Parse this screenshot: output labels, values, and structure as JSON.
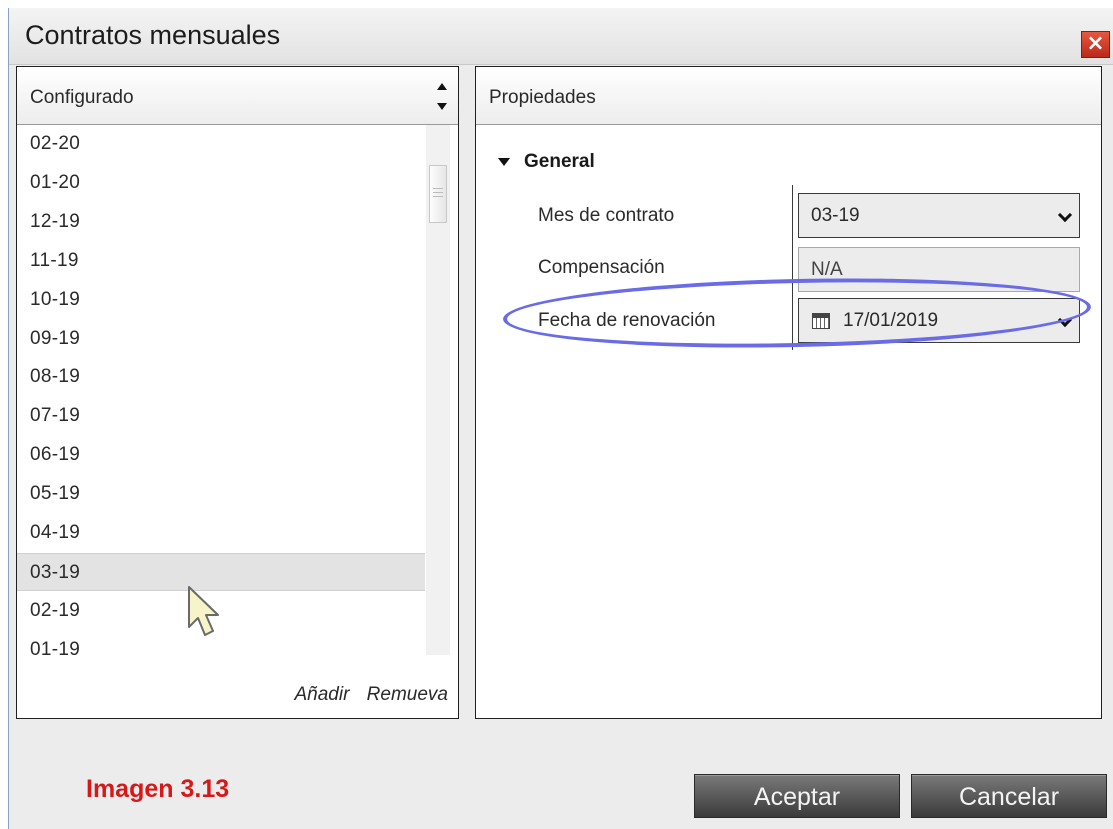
{
  "window": {
    "title": "Contratos mensuales",
    "close_symbol": "×"
  },
  "configured": {
    "header": "Configurado",
    "items": [
      "02-20",
      "01-20",
      "12-19",
      "11-19",
      "10-19",
      "09-19",
      "08-19",
      "07-19",
      "06-19",
      "05-19",
      "04-19",
      "03-19",
      "02-19",
      "01-19"
    ],
    "selected": "03-19",
    "add_label": "Añadir",
    "remove_label": "Remueva"
  },
  "properties": {
    "header": "Propiedades",
    "group": "General",
    "rows": [
      {
        "label": "Mes de contrato",
        "value": "03-19",
        "kind": "select"
      },
      {
        "label": "Compensación",
        "value": "N/A",
        "kind": "readonly"
      },
      {
        "label": "Fecha de renovación",
        "value": "17/01/2019",
        "kind": "date"
      }
    ]
  },
  "caption": "Imagen 3.13",
  "buttons": {
    "ok": "Aceptar",
    "cancel": "Cancelar"
  },
  "colors": {
    "caption": "#d61818",
    "highlight": "#6a6be6",
    "close": "#c8351f"
  },
  "icons": [
    "close-icon",
    "sort-up-icon",
    "sort-down-icon",
    "expand-triangle-icon",
    "chevron-down-icon",
    "calendar-icon",
    "mouse-pointer-icon"
  ]
}
